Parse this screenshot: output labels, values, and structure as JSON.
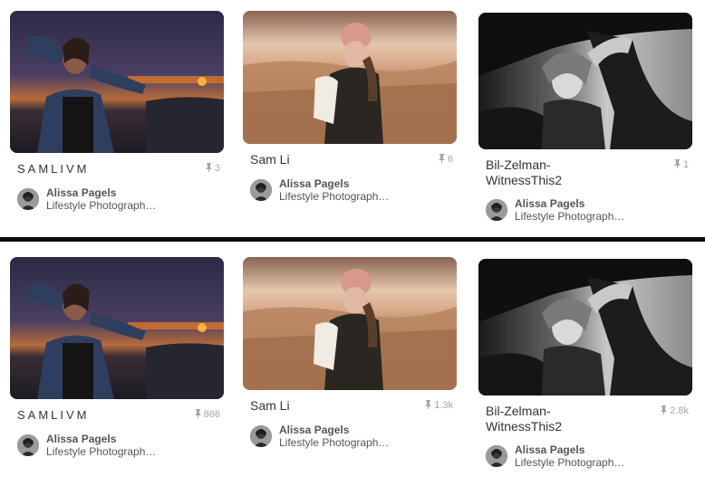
{
  "sections": [
    {
      "pins": [
        {
          "title": "SAMLIVM",
          "saves": "3",
          "author": "Alissa Pagels",
          "board": "Lifestyle Photograph…",
          "image": "woman-by-car-at-sunset-image"
        },
        {
          "title": "Sam Li",
          "saves": "6",
          "author": "Alissa Pagels",
          "board": "Lifestyle Photograph…",
          "image": "woman-in-field-beanie-image"
        },
        {
          "title": "Bil-Zelman-WitnessThis2",
          "saves": "1",
          "author": "Alissa Pagels",
          "board": "Lifestyle Photograph…",
          "image": "woman-in-car-window-bw-image"
        }
      ]
    },
    {
      "pins": [
        {
          "title": "SAMLIVM",
          "saves": "866",
          "author": "Alissa Pagels",
          "board": "Lifestyle Photograph…",
          "image": "woman-by-car-at-sunset-image"
        },
        {
          "title": "Sam Li",
          "saves": "1.3k",
          "author": "Alissa Pagels",
          "board": "Lifestyle Photograph…",
          "image": "woman-in-field-beanie-image"
        },
        {
          "title": "Bil-Zelman-WitnessThis2",
          "saves": "2.8k",
          "author": "Alissa Pagels",
          "board": "Lifestyle Photograph…",
          "image": "woman-in-car-window-bw-image"
        }
      ]
    }
  ],
  "icons": {
    "save": "pin-icon",
    "avatar": "author-avatar"
  },
  "colors": {
    "divider": "#0d0d0d",
    "muted_text": "#a5a5a5",
    "text": "#333333"
  }
}
